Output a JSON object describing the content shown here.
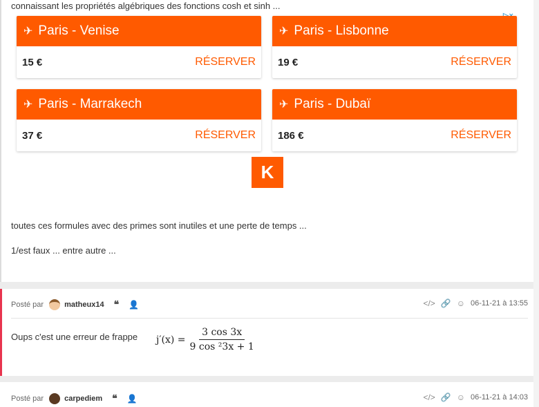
{
  "intro_text": "connaissant les propriétés algébriques des fonctions cosh et sinh ...",
  "ad": {
    "adchoice": "▷×",
    "logo_letter": "K",
    "reserve_label": "RÉSERVER",
    "cards": [
      {
        "route": "Paris - Venise",
        "price": "15 €"
      },
      {
        "route": "Paris - Lisbonne",
        "price": "19 €"
      },
      {
        "route": "Paris - Marrakech",
        "price": "37 €"
      },
      {
        "route": "Paris - Dubaï",
        "price": "186 €"
      }
    ]
  },
  "post1": {
    "line1": "toutes ces formules avec des primes sont inutiles et une perte de temps ...",
    "line2": "1/est faux ... entre autre ..."
  },
  "post2": {
    "posted_by": "Posté par",
    "author": "matheux14",
    "date": "06-11-21 à 13:55",
    "text": "Oups c'est une erreur de frappe",
    "formula_lhs": "j′(x) =",
    "formula_num": "3 cos 3x",
    "formula_den": "9 cos ²3x + 1"
  },
  "post3": {
    "posted_by": "Posté par",
    "author": "carpediem",
    "date": "06-11-21 à 14:03"
  },
  "icons": {
    "quote": "❝",
    "user": "👤",
    "code": "</>",
    "link": "🔗",
    "smile": "☺"
  }
}
